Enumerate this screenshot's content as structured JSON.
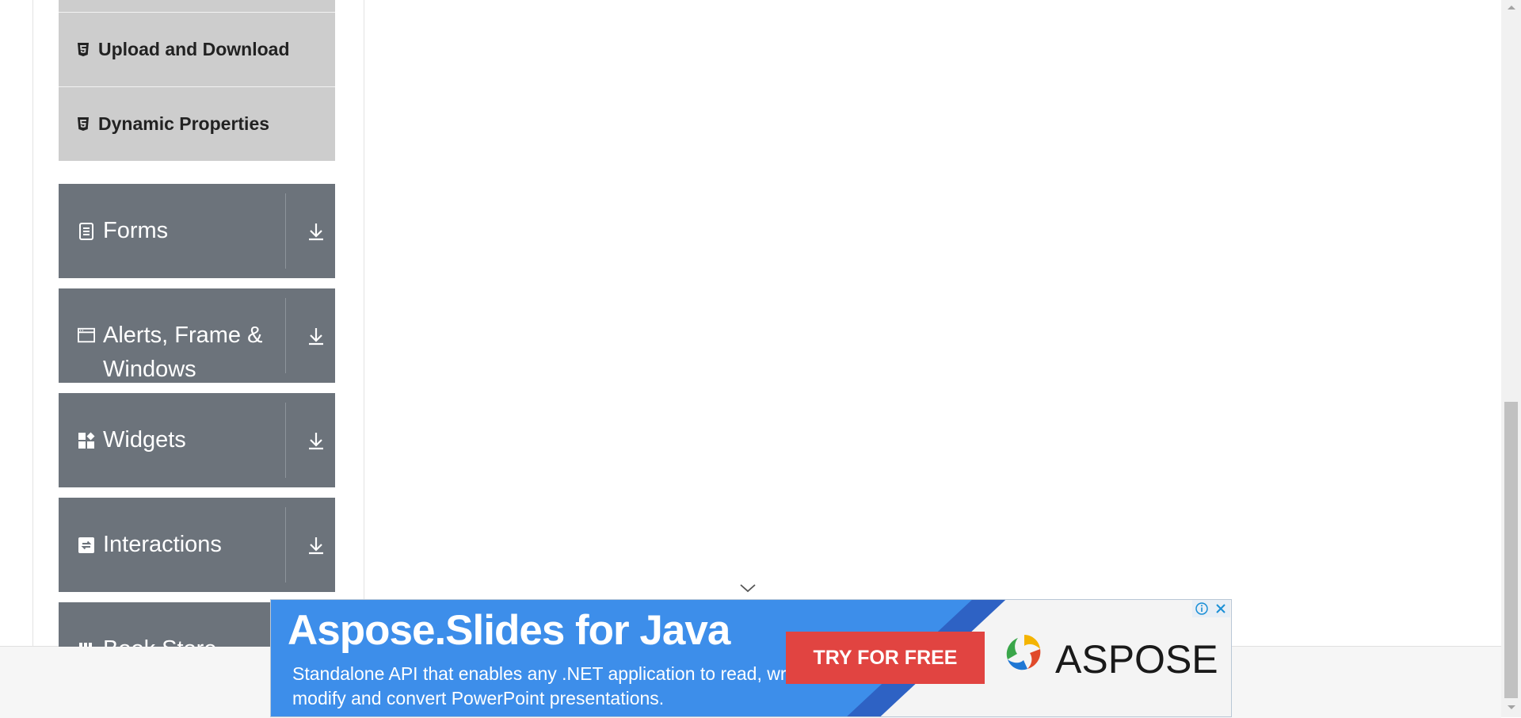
{
  "submenu": {
    "items": [
      {
        "label": "Upload and Download",
        "icon": "html5-icon"
      },
      {
        "label": "Dynamic Properties",
        "icon": "html5-icon"
      }
    ]
  },
  "groups": [
    {
      "label": "Forms",
      "icon": "form-document-icon"
    },
    {
      "label": "Alerts, Frame & Windows",
      "icon": "browser-window-icon"
    },
    {
      "label": "Widgets",
      "icon": "widgets-icon"
    },
    {
      "label": "Interactions",
      "icon": "interactions-icon"
    },
    {
      "label": "Book Store Application",
      "icon": "book-store-icon"
    }
  ],
  "ad": {
    "title": "Aspose.Slides for Java",
    "description": "Standalone API that enables any .NET application to read, write, modify and convert PowerPoint presentations.",
    "cta": "TRY FOR FREE",
    "brand": "ASPOSE"
  },
  "colors": {
    "submenu_bg": "#cdcdcd",
    "group_bg": "#6c737b",
    "ad_blue": "#3d8eea",
    "ad_cta": "#e14441"
  }
}
